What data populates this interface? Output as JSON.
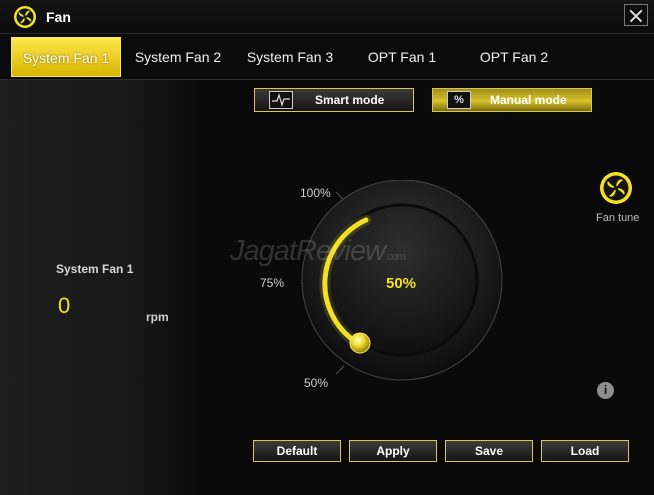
{
  "window": {
    "title": "Fan"
  },
  "tabs": [
    {
      "label": "System Fan 1",
      "active": true
    },
    {
      "label": "System Fan 2",
      "active": false
    },
    {
      "label": "System Fan 3",
      "active": false
    },
    {
      "label": "OPT Fan 1",
      "active": false
    },
    {
      "label": "OPT Fan 2",
      "active": false
    }
  ],
  "fan_status": {
    "name": "System Fan 1",
    "rpm": "0",
    "unit": "rpm"
  },
  "modes": {
    "smart": {
      "label": "Smart mode",
      "icon": "graph-icon"
    },
    "manual": {
      "label": "Manual mode",
      "icon": "percent-icon",
      "icon_text": "%",
      "selected": true
    }
  },
  "dial": {
    "value_text": "50%",
    "value": 50,
    "min": 50,
    "max": 100,
    "labels": {
      "top": "100%",
      "mid": "75%",
      "bottom": "50%"
    }
  },
  "watermark": {
    "main": "JagatReview",
    "suffix": ".com"
  },
  "fan_tune": {
    "label": "Fan tune",
    "icon": "fan-icon"
  },
  "info": {
    "icon": "info-icon",
    "text": "i"
  },
  "actions": {
    "default": "Default",
    "apply": "Apply",
    "save": "Save",
    "load": "Load"
  },
  "colors": {
    "accent": "#f2e21e",
    "background": "#0a0a0a",
    "border_gold": "#d9c45a"
  }
}
